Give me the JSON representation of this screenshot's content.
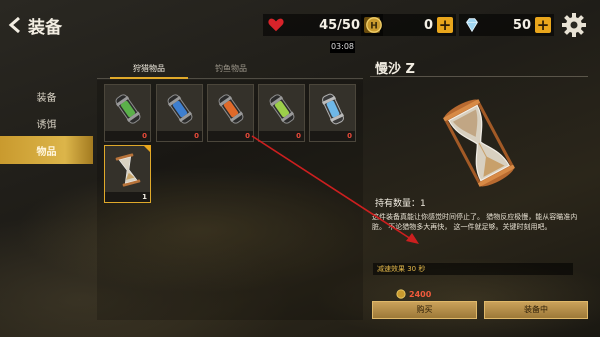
{
  "header": {
    "back_label": "装备",
    "hearts": {
      "value": "45/50",
      "plus": "+"
    },
    "coins": {
      "value": "0",
      "plus": "+"
    },
    "gems": {
      "value": "50",
      "plus": "+"
    },
    "timer": "03:08"
  },
  "sidebar": {
    "items": [
      {
        "label": "装备",
        "active": false
      },
      {
        "label": "诱饵",
        "active": false
      },
      {
        "label": "物品",
        "active": true
      }
    ]
  },
  "tabs": [
    {
      "label": "狩猎物品",
      "active": true
    },
    {
      "label": "钓鱼物品",
      "active": false
    }
  ],
  "items_grid": [
    {
      "icon": "green-capsule-icon",
      "count": "0",
      "color": "#5bb04a"
    },
    {
      "icon": "blue-capsule-icon",
      "count": "0",
      "color": "#3e7fd0"
    },
    {
      "icon": "orange-capsule-icon",
      "count": "0",
      "color": "#e06a2a"
    },
    {
      "icon": "lime-capsule-icon",
      "count": "0",
      "color": "#9ccf4a"
    },
    {
      "icon": "cyan-capsule-icon",
      "count": "0",
      "color": "#6fb8e8"
    },
    {
      "icon": "hourglass-icon",
      "count": "1",
      "selected": true
    }
  ],
  "detail": {
    "title": "慢沙 Z",
    "owned": "持有数量：1",
    "description": "这件装备真能让你感觉时间停止了。 猎物反应极慢，能从容瞄准内脏。 不论猎物多大再快， 这一件就足够。关键时刻用吧。",
    "effect": "减速效果 30 秒",
    "price": "2400",
    "buy_label": "购买",
    "equip_label": "装备中"
  },
  "colors": {
    "accent": "#e0a92a",
    "count_red": "#e84a3a",
    "arrow": "#cc1f1f"
  }
}
